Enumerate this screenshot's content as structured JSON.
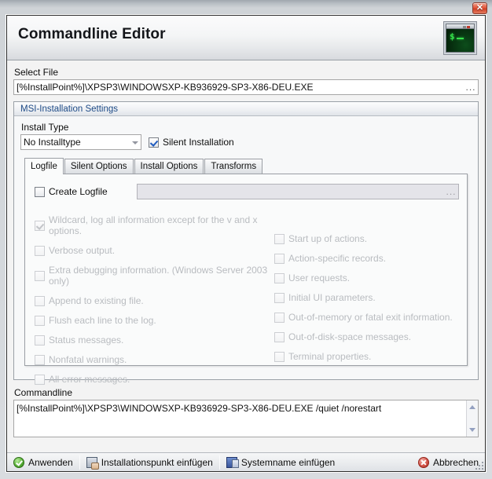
{
  "window": {
    "close_label": "✕"
  },
  "header": {
    "title": "Commandline Editor",
    "icon": "terminal-console-icon",
    "prompt": "$_"
  },
  "select_file": {
    "label": "Select File",
    "value": "[%InstallPoint%]\\XPSP3\\WINDOWSXP-KB936929-SP3-X86-DEU.EXE",
    "browse_label": "..."
  },
  "msi_group": {
    "title": "MSI-Installation Settings",
    "install_type": {
      "label": "Install Type",
      "selected": "No Installtype"
    },
    "silent_installation": {
      "label": "Silent Installation",
      "checked": true
    },
    "tabs": [
      {
        "label": "Logfile",
        "active": true
      },
      {
        "label": "Silent Options",
        "active": false
      },
      {
        "label": "Install Options",
        "active": false
      },
      {
        "label": "Transforms",
        "active": false
      }
    ],
    "logfile_tab": {
      "create_logfile": {
        "label": "Create Logfile",
        "checked": false
      },
      "logfile_path": {
        "value": "",
        "browse_label": "...",
        "disabled": true
      },
      "options_left": [
        {
          "label": "Wildcard, log all information except for the v and x options.",
          "checked": true,
          "disabled": true
        },
        {
          "label": "Verbose output.",
          "checked": false,
          "disabled": true
        },
        {
          "label": "Extra debugging information. (Windows Server 2003 only)",
          "checked": false,
          "disabled": true
        },
        {
          "label": "Append to existing file.",
          "checked": false,
          "disabled": true
        },
        {
          "label": "Flush each line to the log.",
          "checked": false,
          "disabled": true
        },
        {
          "label": "Status messages.",
          "checked": false,
          "disabled": true
        },
        {
          "label": "Nonfatal warnings.",
          "checked": false,
          "disabled": true
        },
        {
          "label": "All error messages.",
          "checked": false,
          "disabled": true
        }
      ],
      "options_right": [
        {
          "label": "Start up of actions.",
          "checked": false,
          "disabled": true
        },
        {
          "label": "Action-specific records.",
          "checked": false,
          "disabled": true
        },
        {
          "label": "User requests.",
          "checked": false,
          "disabled": true
        },
        {
          "label": "Initial UI parameters.",
          "checked": false,
          "disabled": true
        },
        {
          "label": "Out-of-memory or fatal exit information.",
          "checked": false,
          "disabled": true
        },
        {
          "label": "Out-of-disk-space messages.",
          "checked": false,
          "disabled": true
        },
        {
          "label": "Terminal properties.",
          "checked": false,
          "disabled": true
        }
      ]
    }
  },
  "commandline": {
    "label": "Commandline",
    "value": "[%InstallPoint%]\\XPSP3\\WINDOWSXP-KB936929-SP3-X86-DEU.EXE /quiet /norestart"
  },
  "statusbar": {
    "apply": {
      "label": "Anwenden",
      "accel": "w",
      "icon": "green-check-circle-icon"
    },
    "insert_installpoint": {
      "label": "Installationspunkt einfügen",
      "accel": "I",
      "icon": "monitor-hand-icon"
    },
    "insert_systemname": {
      "label": "Systemname einfügen",
      "accel": "S",
      "icon": "computer-icon"
    },
    "cancel": {
      "label": "Abbrechen",
      "accel": "A",
      "icon": "red-x-circle-icon"
    }
  },
  "colors": {
    "group_header_text": "#1d4a86",
    "checkbox_check": "#1f5bbf",
    "ok_green": "#5cb33a",
    "cancel_red": "#d4564b",
    "terminal_green": "#35e04a",
    "close_red": "#e2583d"
  }
}
